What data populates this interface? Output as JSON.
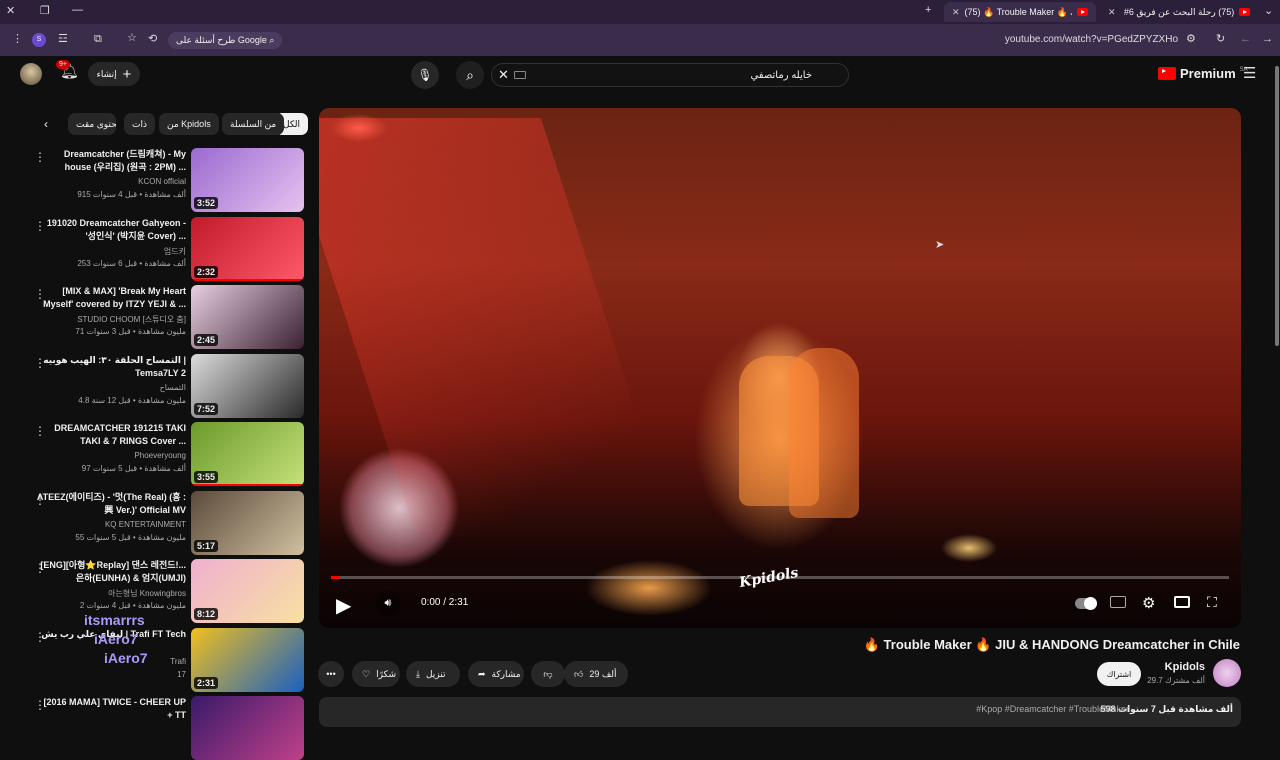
{
  "browser": {
    "tabs": [
      {
        "label": "(75) رحلة البحث عن فريق 6# | ال"
      },
      {
        "label": "(75) 🔥 Trouble Maker 🔥 JIU &",
        "active": true
      }
    ],
    "url": "youtube.com/watch?v=PGedZPYZXHo",
    "google_pill": "طرح أسئلة على Google",
    "profile_letter": "S"
  },
  "youtube": {
    "logo_text": "Premium",
    "logo_sup": "SA",
    "search_value": "خايله رماتصفي",
    "create_label": "إنشاء",
    "notif_count": "9+"
  },
  "chips": [
    "الكل",
    "من السلسلة",
    "من Kpidols",
    "ذات",
    "محتوى مقت"
  ],
  "recommendations": [
    {
      "title": "Dreamcatcher (드림캐쳐) - My house (우리집) (원곡 : 2PM) ...",
      "channel": "KCON official",
      "meta": "915 ألف مشاهدة • قبل 4 سنوات",
      "duration": "3:52",
      "colors": [
        "#9a6ad0",
        "#e6c2f0"
      ]
    },
    {
      "title": "191020 Dreamcatcher Gahyeon - '성인식' (박지윤 Cover) ...",
      "channel": "엄드키",
      "meta": "253 ألف مشاهدة • قبل 6 سنوات",
      "duration": "2:32",
      "colors": [
        "#c21a2a",
        "#ff5a6a"
      ]
    },
    {
      "title": "[MIX & MAX] 'Break My Heart Myself' covered by ITZY YEJI & ...",
      "channel": "STUDIO CHOOM [스튜디오 춤]",
      "meta": "71 مليون مشاهدة • قبل 3 سنوات",
      "duration": "2:45",
      "colors": [
        "#e8d0e0",
        "#3a2030"
      ]
    },
    {
      "title": "التمساح الحلقة ٣٠: الهيب هوبيه | Temsa7LY 2",
      "channel": "التمساح",
      "meta": "4.8 مليون مشاهدة • قبل 12 سنة",
      "duration": "7:52",
      "colors": [
        "#dcdcdc",
        "#2a2a2a"
      ]
    },
    {
      "title": "DREAMCATCHER 191215 TAKI TAKI & 7 RINGS Cover ...",
      "channel": "Phoeveryoung",
      "meta": "97 ألف مشاهدة • قبل 5 سنوات",
      "duration": "3:55",
      "colors": [
        "#6a9a2a",
        "#c6e07a"
      ]
    },
    {
      "title": "ATEEZ(에이티즈) - '멋(The Real) (흥 : 興 Ver.)' Official MV",
      "channel": "KQ ENTERTAINMENT",
      "meta": "55 مليون مشاهدة • قبل 5 سنوات",
      "duration": "5:17",
      "colors": [
        "#5a4a3a",
        "#d0c0a0"
      ]
    },
    {
      "title": "[ENG][아형⭐Replay] 댄스 레전드!... 은하(EUNHA) & 엄지(UMJI)",
      "channel": "아는형님 Knowingbros",
      "meta": "2 مليون مشاهدة • قبل 4 سنوات",
      "duration": "8:12",
      "colors": [
        "#f0b0d0",
        "#f8e0a0"
      ]
    },
    {
      "title": "ليفاي علي رب يش | Trafi FT Tech",
      "channel": "Trafi",
      "meta": "17",
      "duration": "2:31",
      "colors": [
        "#f0c020",
        "#1a60c0"
      ],
      "overlay": [
        "itsmarrrs",
        "iAero7",
        "iAero7"
      ]
    },
    {
      "title": "[2016 MAMA] TWICE - CHEER UP + TT",
      "channel": "",
      "meta": "",
      "duration": "",
      "colors": [
        "#3a1a6a",
        "#c0408a"
      ]
    }
  ],
  "player": {
    "time": "0:00 / 2:31",
    "progress_fraction": 0.01,
    "watermark": "Kpidols"
  },
  "video": {
    "title": "🔥 Trouble Maker 🔥 JIU & HANDONG Dreamcatcher in Chile",
    "channel": "Kpidols",
    "subscribers": "29.7 ألف مشترك",
    "subscribe_label": "اشتراك",
    "likes": "29 ألف",
    "share_label": "مشاركة",
    "download_label": "تنزيل",
    "thanks_label": "شكرًا",
    "desc_stats": "598 ألف مشاهدة  قبل 7 سنوات",
    "desc_tags": "#Kpop #Dreamcatcher #TroubleMaker"
  }
}
